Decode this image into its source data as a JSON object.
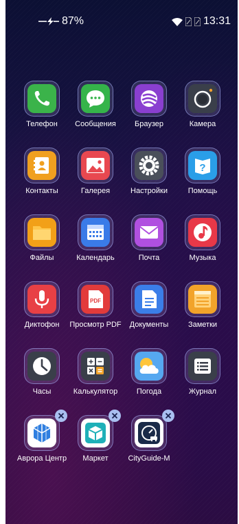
{
  "status_bar": {
    "battery_percent": "87%",
    "time": "13:31"
  },
  "apps": [
    {
      "label": "Телефон"
    },
    {
      "label": "Сообщения"
    },
    {
      "label": "Браузер"
    },
    {
      "label": "Камера"
    },
    {
      "label": "Контакты"
    },
    {
      "label": "Галерея"
    },
    {
      "label": "Настройки"
    },
    {
      "label": "Помощь"
    },
    {
      "label": "Файлы"
    },
    {
      "label": "Календарь"
    },
    {
      "label": "Почта"
    },
    {
      "label": "Музыка"
    },
    {
      "label": "Диктофон"
    },
    {
      "label": "Просмотр PDF"
    },
    {
      "label": "Документы"
    },
    {
      "label": "Заметки"
    },
    {
      "label": "Часы"
    },
    {
      "label": "Калькулятор"
    },
    {
      "label": "Погода"
    },
    {
      "label": "Журнал"
    },
    {
      "label": "Аврора Центр"
    },
    {
      "label": "Маркет"
    },
    {
      "label": "CityGuide-M"
    }
  ],
  "icons": {
    "phone": "phone-icon",
    "messages": "chat-bubble-icon",
    "browser": "browser-icon",
    "camera": "camera-icon",
    "contacts": "contact-card-icon",
    "gallery": "picture-icon",
    "settings": "gear-icon",
    "help": "question-icon",
    "files": "folder-icon",
    "calendar": "calendar-icon",
    "mail": "envelope-icon",
    "music": "music-note-icon",
    "recorder": "microphone-icon",
    "pdf": "pdf-document-icon",
    "documents": "document-icon",
    "notes": "notes-icon",
    "clock": "clock-icon",
    "calculator": "calculator-icon",
    "weather": "weather-icon",
    "journal": "list-icon",
    "aurora": "cube-icon",
    "market": "box-icon",
    "cityguide": "navigator-icon",
    "remove": "close-icon"
  },
  "colors": {
    "phone": "#3bb34a",
    "messages": "#35b44a",
    "browser": "#8a3fd0",
    "camera": "#3a3f4a",
    "contacts": "#f0a020",
    "gallery": "#e84850",
    "settings": "#4a4f5a",
    "help": "#2a9ee8",
    "files": "#f2a018",
    "calendar": "#3a7be8",
    "mail": "#b050e0",
    "music": "#e83848",
    "recorder": "#e84045",
    "pdf": "#e23b3b",
    "documents": "#3b7ee8",
    "notes": "#f2a32a",
    "clock": "#3a3f4a",
    "calculator": "#3a3f4a",
    "weather": "#56a8f0",
    "journal": "#3a3f4a",
    "remove_badge": "#a9bff0"
  }
}
